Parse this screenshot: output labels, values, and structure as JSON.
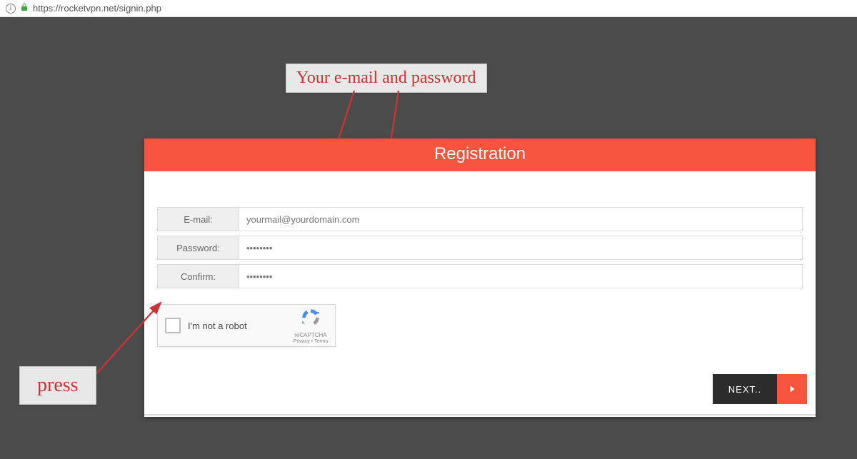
{
  "browser": {
    "url_display": "https://rocketvpn.net/signin.php"
  },
  "card": {
    "title": "Registration"
  },
  "form": {
    "email": {
      "label": "E-mail:",
      "placeholder": "yourmail@yourdomain.com",
      "value": ""
    },
    "password": {
      "label": "Password:",
      "placeholder": "••••••••",
      "value": ""
    },
    "confirm": {
      "label": "Confirm:",
      "placeholder": "••••••••",
      "value": ""
    }
  },
  "recaptcha": {
    "label": "I'm not a robot",
    "brand": "reCAPTCHA",
    "links": "Privacy • Terms"
  },
  "buttons": {
    "next": "NEXT.."
  },
  "annotations": {
    "top": "Your e-mail and password",
    "bottom": "press"
  }
}
